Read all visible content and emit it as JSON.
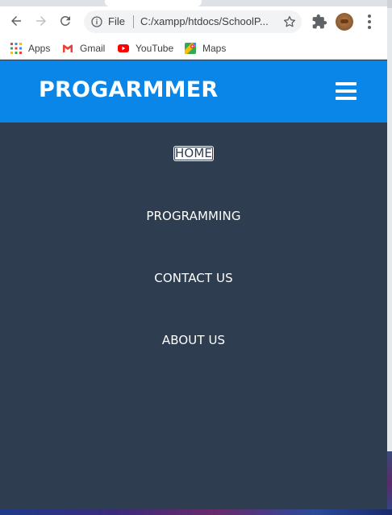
{
  "browser": {
    "omnibox": {
      "scheme": "File",
      "url": "C:/xampp/htdocs/SchoolP..."
    }
  },
  "bookmarks": [
    {
      "label": "Apps",
      "icon": "apps-grid-icon"
    },
    {
      "label": "Gmail",
      "icon": "gmail-icon"
    },
    {
      "label": "YouTube",
      "icon": "youtube-icon"
    },
    {
      "label": "Maps",
      "icon": "maps-icon"
    }
  ],
  "site": {
    "brand": "PROGARMMER",
    "menu": [
      {
        "label": "HOME",
        "active": true
      },
      {
        "label": "PROGRAMMING",
        "active": false
      },
      {
        "label": "CONTACT US",
        "active": false
      },
      {
        "label": "ABOUT US",
        "active": false
      }
    ]
  },
  "colors": {
    "header": "#0986e8",
    "menu_background": "#2e3d50",
    "text": "#ffffff"
  }
}
